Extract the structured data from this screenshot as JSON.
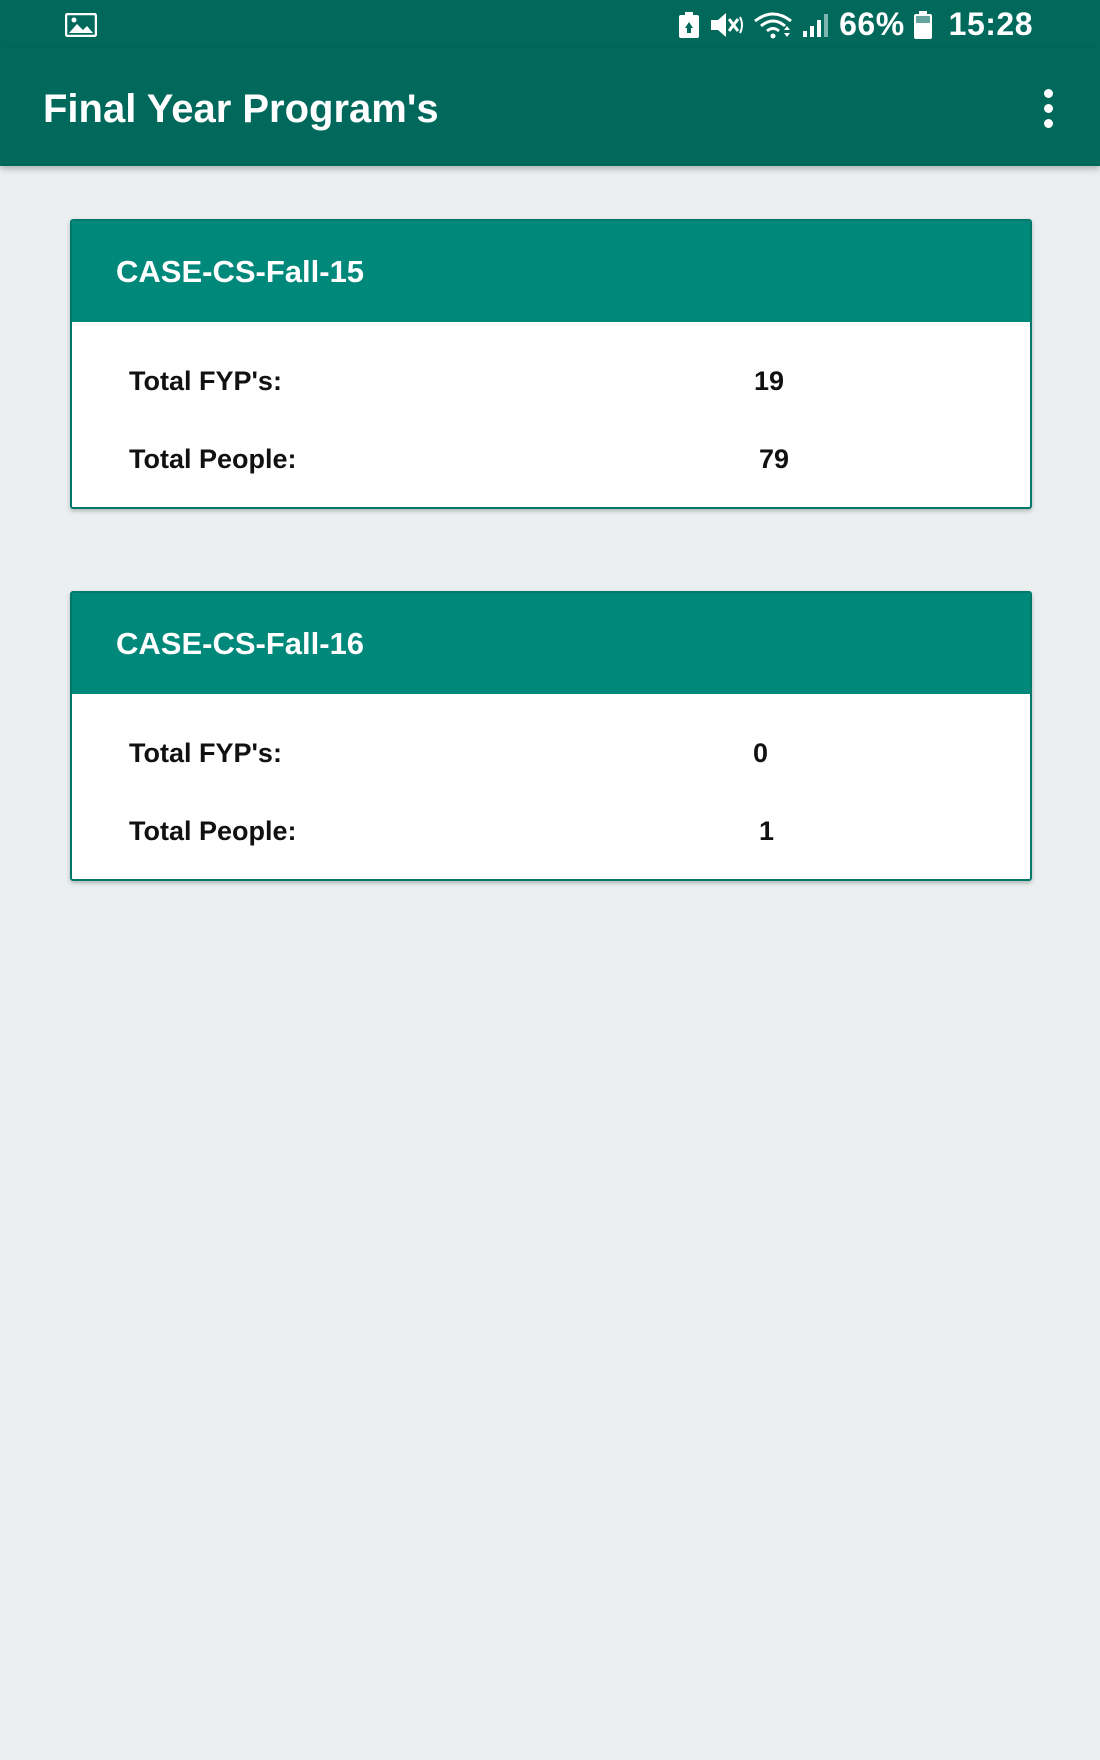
{
  "status_bar": {
    "battery_percent": "66%",
    "time": "15:28",
    "icons": [
      "gallery-icon",
      "battery-saver-icon",
      "mute-icon",
      "wifi-icon",
      "signal-icon",
      "battery-icon"
    ]
  },
  "app_bar": {
    "title": "Final Year Program's",
    "menu_icon": "more-vert-icon"
  },
  "cards": [
    {
      "title": "CASE-CS-Fall-15",
      "rows": [
        {
          "label": "Total FYP's:",
          "value": "19"
        },
        {
          "label": "Total People:",
          "value": "79"
        }
      ]
    },
    {
      "title": "CASE-CS-Fall-16",
      "rows": [
        {
          "label": "Total FYP's:",
          "value": "0"
        },
        {
          "label": "Total People:",
          "value": "1"
        }
      ]
    }
  ],
  "colors": {
    "primary_dark": "#00695c",
    "card_header": "#00897b",
    "background": "#ebeff0",
    "card_border": "#00796b"
  }
}
